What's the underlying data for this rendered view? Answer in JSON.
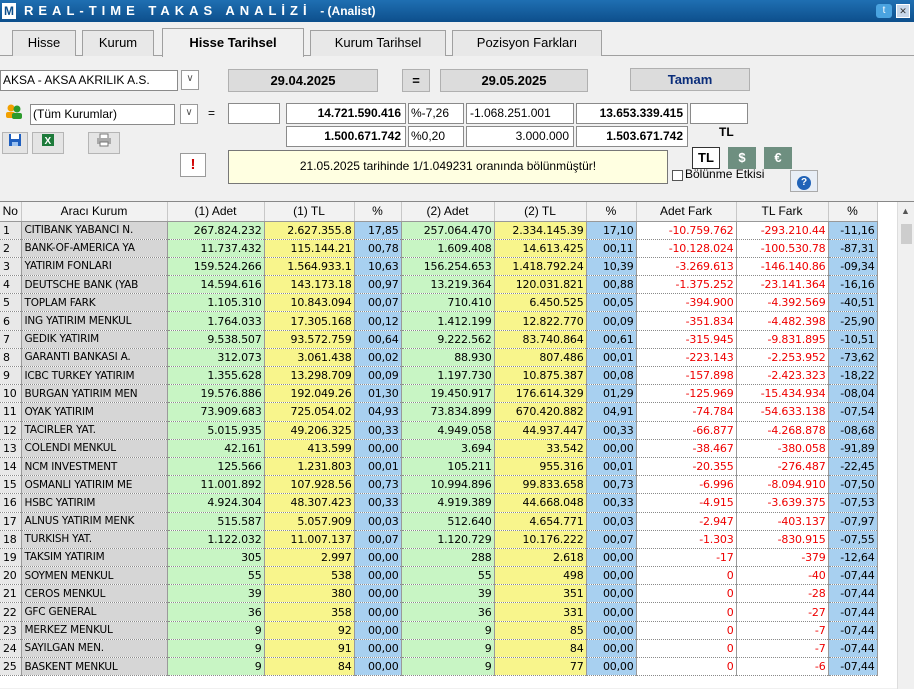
{
  "app": {
    "logo": "M",
    "title": "REAL-TIME TAKAS ANALİZİ",
    "subtitle": "- (Analist)",
    "twitter_icon": "twitter-icon",
    "close_icon": "close-icon"
  },
  "tabs": [
    "Hisse",
    "Kurum",
    "Hisse Tarihsel",
    "Kurum Tarihsel",
    "Pozisyon Farkları"
  ],
  "form": {
    "stock": "AKSA - AKSA AKRILIK A.S.",
    "date_start": "29.04.2025",
    "equals": "=",
    "date_end": "29.05.2025",
    "ok_button": "Tamam",
    "institutions": "(Tüm Kurumlar)",
    "eq2": "=",
    "val1": "14.721.590.416",
    "pct1": "%-7,26",
    "diff1": "-1.068.251.001",
    "val2": "13.653.339.415",
    "val3": "1.500.671.742",
    "pct2": "%0,20",
    "diff2": "3.000.000",
    "val4": "1.503.671.742",
    "currency_label": "TL",
    "currency_tl": "TL",
    "currency_usd": "$",
    "currency_eur": "€",
    "warning_mark": "!",
    "notice": "21.05.2025 tarihinde 1/1.049231 oranında bölünmüştür!",
    "split_effect": "Bölünme Etkisi",
    "help": "?"
  },
  "table": {
    "headers": [
      "No",
      "Aracı Kurum",
      "(1) Adet",
      "(1) TL",
      "%",
      "(2) Adet",
      "(2) TL",
      "%",
      "Adet Fark",
      "TL Fark",
      "%"
    ],
    "rows": [
      [
        "1",
        "CITIBANK YABANCI N.",
        "267.824.232",
        "2.627.355.8",
        "17,85",
        "257.064.470",
        "2.334.145.39",
        "17,10",
        "-10.759.762",
        "-293.210.44",
        "-11,16"
      ],
      [
        "2",
        "BANK-OF-AMERICA YA",
        "11.737.432",
        "115.144.21",
        "00,78",
        "1.609.408",
        "14.613.425",
        "00,11",
        "-10.128.024",
        "-100.530.78",
        "-87,31"
      ],
      [
        "3",
        "YATIRIM FONLARI",
        "159.524.266",
        "1.564.933.1",
        "10,63",
        "156.254.653",
        "1.418.792.24",
        "10,39",
        "-3.269.613",
        "-146.140.86",
        "-09,34"
      ],
      [
        "4",
        "DEUTSCHE BANK (YAB",
        "14.594.616",
        "143.173.18",
        "00,97",
        "13.219.364",
        "120.031.821",
        "00,88",
        "-1.375.252",
        "-23.141.364",
        "-16,16"
      ],
      [
        "5",
        "TOPLAM FARK",
        "1.105.310",
        "10.843.094",
        "00,07",
        "710.410",
        "6.450.525",
        "00,05",
        "-394.900",
        "-4.392.569",
        "-40,51"
      ],
      [
        "6",
        "ING YATIRIM MENKUL",
        "1.764.033",
        "17.305.168",
        "00,12",
        "1.412.199",
        "12.822.770",
        "00,09",
        "-351.834",
        "-4.482.398",
        "-25,90"
      ],
      [
        "7",
        "GEDIK YATIRIM",
        "9.538.507",
        "93.572.759",
        "00,64",
        "9.222.562",
        "83.740.864",
        "00,61",
        "-315.945",
        "-9.831.895",
        "-10,51"
      ],
      [
        "8",
        "GARANTI BANKASI A.",
        "312.073",
        "3.061.438",
        "00,02",
        "88.930",
        "807.486",
        "00,01",
        "-223.143",
        "-2.253.952",
        "-73,62"
      ],
      [
        "9",
        "ICBC TURKEY YATIRIM",
        "1.355.628",
        "13.298.709",
        "00,09",
        "1.197.730",
        "10.875.387",
        "00,08",
        "-157.898",
        "-2.423.323",
        "-18,22"
      ],
      [
        "10",
        "BURGAN YATIRIM MEN",
        "19.576.886",
        "192.049.26",
        "01,30",
        "19.450.917",
        "176.614.329",
        "01,29",
        "-125.969",
        "-15.434.934",
        "-08,04"
      ],
      [
        "11",
        "OYAK YATIRIM",
        "73.909.683",
        "725.054.02",
        "04,93",
        "73.834.899",
        "670.420.882",
        "04,91",
        "-74.784",
        "-54.633.138",
        "-07,54"
      ],
      [
        "12",
        "TACIRLER YAT.",
        "5.015.935",
        "49.206.325",
        "00,33",
        "4.949.058",
        "44.937.447",
        "00,33",
        "-66.877",
        "-4.268.878",
        "-08,68"
      ],
      [
        "13",
        "COLENDI MENKUL",
        "42.161",
        "413.599",
        "00,00",
        "3.694",
        "33.542",
        "00,00",
        "-38.467",
        "-380.058",
        "-91,89"
      ],
      [
        "14",
        "NCM INVESTMENT",
        "125.566",
        "1.231.803",
        "00,01",
        "105.211",
        "955.316",
        "00,01",
        "-20.355",
        "-276.487",
        "-22,45"
      ],
      [
        "15",
        "OSMANLI YATIRIM ME",
        "11.001.892",
        "107.928.56",
        "00,73",
        "10.994.896",
        "99.833.658",
        "00,73",
        "-6.996",
        "-8.094.910",
        "-07,50"
      ],
      [
        "16",
        "HSBC YATIRIM",
        "4.924.304",
        "48.307.423",
        "00,33",
        "4.919.389",
        "44.668.048",
        "00,33",
        "-4.915",
        "-3.639.375",
        "-07,53"
      ],
      [
        "17",
        "ALNUS YATIRIM MENK",
        "515.587",
        "5.057.909",
        "00,03",
        "512.640",
        "4.654.771",
        "00,03",
        "-2.947",
        "-403.137",
        "-07,97"
      ],
      [
        "18",
        "TURKISH YAT.",
        "1.122.032",
        "11.007.137",
        "00,07",
        "1.120.729",
        "10.176.222",
        "00,07",
        "-1.303",
        "-830.915",
        "-07,55"
      ],
      [
        "19",
        "TAKSIM YATIRIM",
        "305",
        "2.997",
        "00,00",
        "288",
        "2.618",
        "00,00",
        "-17",
        "-379",
        "-12,64"
      ],
      [
        "20",
        "SOYMEN MENKUL",
        "55",
        "538",
        "00,00",
        "55",
        "498",
        "00,00",
        "0",
        "-40",
        "-07,44"
      ],
      [
        "21",
        "CEROS MENKUL",
        "39",
        "380",
        "00,00",
        "39",
        "351",
        "00,00",
        "0",
        "-28",
        "-07,44"
      ],
      [
        "22",
        "GFC GENERAL",
        "36",
        "358",
        "00,00",
        "36",
        "331",
        "00,00",
        "0",
        "-27",
        "-07,44"
      ],
      [
        "23",
        "MERKEZ MENKUL",
        "9",
        "92",
        "00,00",
        "9",
        "85",
        "00,00",
        "0",
        "-7",
        "-07,44"
      ],
      [
        "24",
        "SAYILGAN MEN.",
        "9",
        "91",
        "00,00",
        "9",
        "84",
        "00,00",
        "0",
        "-7",
        "-07,44"
      ],
      [
        "25",
        "BASKENT MENKUL",
        "9",
        "84",
        "00,00",
        "9",
        "77",
        "00,00",
        "0",
        "-6",
        "-07,44"
      ]
    ]
  },
  "colors": {
    "green": "#c8f5c4",
    "yellow": "#f8f58c",
    "blue": "#a8d0f0",
    "negative": "#ee0000"
  }
}
